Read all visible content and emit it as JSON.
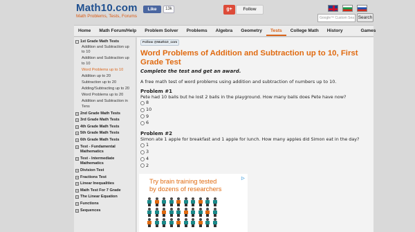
{
  "header": {
    "logo_title": "Math10.com",
    "logo_subtitle": "Math Problems, Tests, Forums",
    "fb_like_label": "Like",
    "fb_like_count": "13k",
    "gplus_icon": "g+",
    "follow_label": "Follow",
    "search_placeholder": "Google™ Custom Sea",
    "search_button": "Search"
  },
  "nav": {
    "items": [
      "Home",
      "Math Forum/Help",
      "Problem Solver",
      "Problems",
      "Algebra",
      "Geometry",
      "Tests",
      "College Math",
      "History",
      "Games"
    ],
    "active": "Tests"
  },
  "sidebar": {
    "cat_1st": "1st Grade Math Tests",
    "sub": [
      "Addition and Subtraction up to 10",
      "Addition and Subtraction up to 10",
      "Word Problems up to 10",
      "Addition up to 20",
      "Subtraction up to 20",
      "Adding/Subtracting up to 20",
      "Word Problems up to 20",
      "Addition and Subtraction in Tens"
    ],
    "cats": [
      "2nd Grade Math Tests",
      "3rd Grade Math Tests",
      "4th Grade Math Tests",
      "5th Grade Math Tests",
      "6th Grade Math Tests",
      "Test - Fundamental Mathematics",
      "Test - Intermediate Mathematics",
      "Division Test",
      "Fractions Test",
      "Linear Inequalities",
      "Math Test For 7 Grade",
      "The Linear Equation",
      "Functions",
      "Sequences"
    ]
  },
  "main": {
    "follow_twitter": "Follow @Math10_com",
    "title": "Word Problems of Addition and Subtraction up to 10, First Grade Test",
    "subtitle": "Complete the test and get an award.",
    "intro": "A free math test of word problems using addition and subtraction of numbers up to 10.",
    "problems": [
      {
        "heading": "Problem #1",
        "text": "Pete had 10 balls but he lost 2 balls in the playground. How many balls does Pete have now?",
        "options": [
          "8",
          "10",
          "9",
          "6"
        ]
      },
      {
        "heading": "Problem #2",
        "text": "Simon ate 1 apple for breakfast and 1 apple for lunch. How many apples did Simon eat in the day?",
        "options": [
          "1",
          "3",
          "4",
          "2"
        ]
      }
    ]
  },
  "ad": {
    "text_line1": "Try brain training tested",
    "text_line2": "by dozens of researchers",
    "badge": "▷"
  },
  "colors": {
    "accent_orange": "#e06a10",
    "logo_blue": "#1e4f8f",
    "facebook_blue": "#4a66a0",
    "gplus_red": "#dd4b39"
  }
}
